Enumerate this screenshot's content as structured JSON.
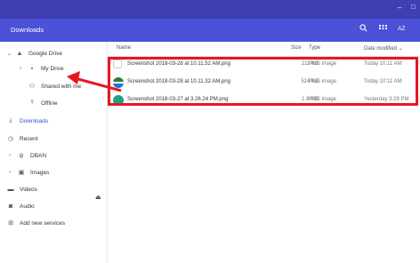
{
  "window": {
    "minimize_glyph": "–",
    "maximize_glyph": "□"
  },
  "header": {
    "title": "Downloads",
    "search_icon": "search-icon",
    "grid_icon": "grid-view-icon",
    "sort_label": "AZ"
  },
  "sidebar": {
    "items": [
      {
        "label": "Google Drive",
        "icon": "drive-icon",
        "chevron": "⌄"
      },
      {
        "label": "My Drive",
        "icon": "folder-icon",
        "chevron": "›"
      },
      {
        "label": "Shared with me",
        "icon": "people-icon",
        "chevron": ""
      },
      {
        "label": "Offline",
        "icon": "pin-icon",
        "chevron": ""
      },
      {
        "label": "Downloads",
        "icon": "download-icon",
        "chevron": ""
      },
      {
        "label": "Recent",
        "icon": "clock-icon",
        "chevron": ""
      },
      {
        "label": "DBAN",
        "icon": "usb-icon",
        "chevron": "›"
      },
      {
        "label": "Images",
        "icon": "image-icon",
        "chevron": "›"
      },
      {
        "label": "Videos",
        "icon": "video-icon",
        "chevron": ""
      },
      {
        "label": "Audio",
        "icon": "audio-icon",
        "chevron": ""
      },
      {
        "label": "Add new services",
        "icon": "add-icon",
        "chevron": ""
      }
    ],
    "eject_glyph": "⏏"
  },
  "columns": {
    "name": "Name",
    "size": "Size",
    "type": "Type",
    "date": "Date modified ⌄"
  },
  "files": [
    {
      "name": "Screenshot 2018-03-28 at 10.11.52 AM.png",
      "size": "211 KB",
      "type": "PNG image",
      "date": "Today 10:11 AM"
    },
    {
      "name": "Screenshot 2018-03-28 at 10.11.32 AM.png",
      "size": "524 KB",
      "type": "PNG image",
      "date": "Today 10:11 AM"
    },
    {
      "name": "Screenshot 2018-03-27 at 3.26.24 PM.png",
      "size": "1.9 MB",
      "type": "PNG image",
      "date": "Yesterday 3:26 PM"
    }
  ],
  "colors": {
    "titlebar": "#3f3fb3",
    "header": "#4b52d7",
    "accent": "#3a4ad6",
    "annotation": "#e8161e"
  }
}
